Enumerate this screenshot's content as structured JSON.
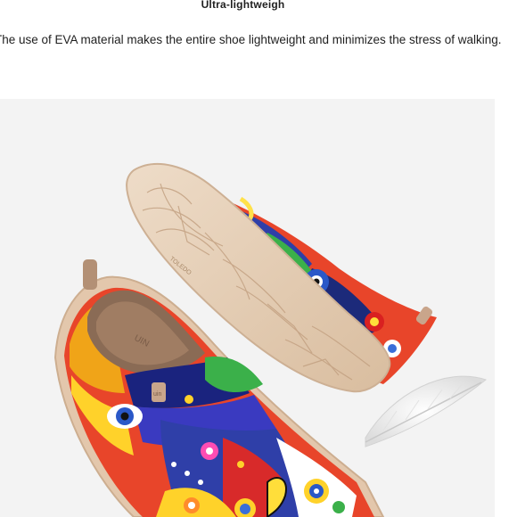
{
  "feature": {
    "title": "Ultra-lightweigh",
    "description": "The use of EVA material makes the entire shoe lightweight and minimizes the stress of walking."
  },
  "image": {
    "subject": "pair of colorful painted slip-on shoes with feather",
    "sole_brand_text": "TOLEDO",
    "heel_tab_text": "uin",
    "insole_text": "UIN"
  },
  "colors": {
    "background": "#ffffff",
    "image_background": "#f3f3f3",
    "sole": "#e6cdb3",
    "insole": "#8a6b55"
  }
}
